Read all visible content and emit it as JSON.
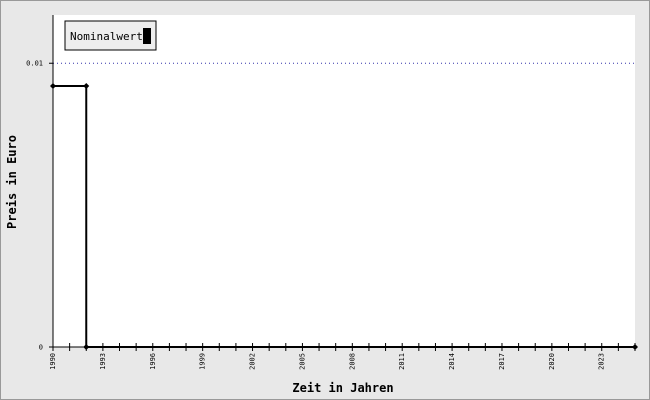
{
  "chart_data": {
    "type": "line",
    "title": "",
    "xlabel": "Zeit in Jahren",
    "ylabel": "Preis in Euro",
    "x_tick_labels": [
      "1990",
      "1993",
      "1996",
      "1999",
      "2002",
      "2005",
      "2008",
      "2011",
      "2014",
      "2017",
      "2020",
      "2023"
    ],
    "y_tick_labels": [
      "0",
      "0.01"
    ],
    "xlim": [
      1990,
      2025
    ],
    "ylim": [
      0,
      0.0117
    ],
    "step": true,
    "grid": false,
    "reference_line": {
      "value": 0.01,
      "style": "dotted",
      "color": "#3333aa"
    },
    "legend": {
      "placement": "top-left",
      "entries": [
        "Nominalwert"
      ]
    },
    "series": [
      {
        "name": "Nominalwert",
        "color": "#000000",
        "points": [
          {
            "x": 1990,
            "y": 0.0092
          },
          {
            "x": 1992,
            "y": 0.0092
          },
          {
            "x": 1992,
            "y": 0
          },
          {
            "x": 2025,
            "y": 0
          }
        ]
      }
    ]
  },
  "colors": {
    "frame_background": "#e8e8e8",
    "plot_background": "#ffffff",
    "axis": "#000000",
    "legend_background": "#eeeeee"
  }
}
